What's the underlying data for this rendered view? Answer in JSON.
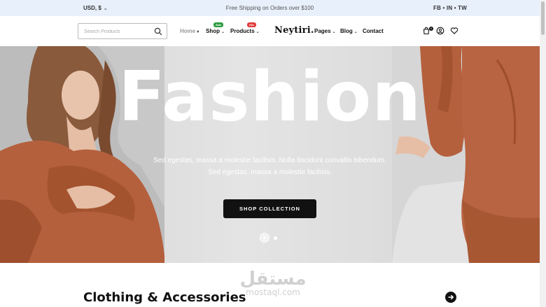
{
  "topbar": {
    "currency": "USD, $",
    "promo": "Free Shipping on Orders over $100",
    "social": "FB • IN • TW"
  },
  "header": {
    "search_placeholder": "Search Products",
    "nav": {
      "home": "Home",
      "shop": "Shop",
      "shop_badge": "Sale",
      "products": "Products",
      "products_badge": "Hot",
      "pages": "Pages",
      "blog": "Blog",
      "contact": "Contact"
    },
    "logo": "Neytiri.",
    "cart_count": "0"
  },
  "hero": {
    "title": "Fashion",
    "subtitle_line1": "Sed egestas, massa a molestie facilisis. Nulla tincidunt convallis bibendum.",
    "subtitle_line2": "Sed egestas, massa a molestie facilisis.",
    "button": "SHOP COLLECTION",
    "slide_count": 2,
    "active_slide": 1
  },
  "section": {
    "title": "Clothing & Accessories"
  },
  "watermark": {
    "arabic": "مستقل",
    "latin": "mostaql.com"
  },
  "colors": {
    "topbar_bg": "#e8f0fb",
    "accent_dark": "#111111",
    "badge_green": "#2e9b3e",
    "badge_red": "#e23b3b",
    "outfit_rust": "#b5603d"
  }
}
